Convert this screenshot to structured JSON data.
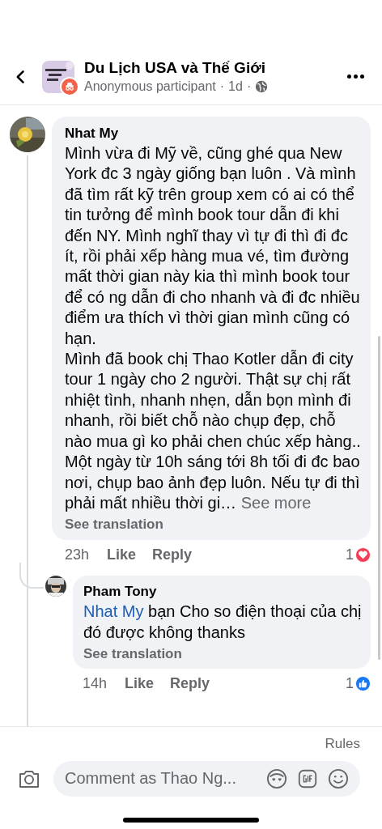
{
  "header": {
    "title": "Du Lịch USA và Thế Giới",
    "subtitle_parts": [
      "Anonymous participant",
      "·",
      "1d",
      "·"
    ]
  },
  "comments": [
    {
      "author": "Nhat My",
      "paragraphs": [
        "Mình vừa đi Mỹ về, cũng ghé qua New York đc 3 ngày giống bạn luôn . Và mình đã tìm rất kỹ trên group xem có ai có thể tin tưởng để mình book tour dẫn đi khi đến NY. Mình nghĩ thay vì tự đi thì đi đc ít, rồi phải xếp hàng mua vé, tìm đường mất thời gian này kia thì mình book tour để có ng dẫn đi cho nhanh và đi đc nhiều điểm ưa thích vì thời gian mình cũng có hạn.",
        "Mình đã book chị Thao Kotler dẫn đi city tour 1 ngày cho 2 người. Thật sự chị rất nhiệt tình, nhanh nhẹn, dẫn bọn mình đi nhanh, rồi biết chỗ nào chụp đẹp, chỗ nào mua gì ko phải chen chúc xếp hàng..",
        "Một ngày từ 10h sáng tới 8h tối đi đc bao nơi, chụp bao ảnh đẹp luôn. Nếu tự đi thì phải mất nhiều thời gi…"
      ],
      "see_more": "See more",
      "translation": "See translation",
      "time": "23h",
      "like": "Like",
      "reply": "Reply",
      "reactions": [
        {
          "kind": "love",
          "count": "1"
        }
      ],
      "replies": [
        {
          "author": "Pham Tony",
          "mention": "Nhat My",
          "paragraphs": [
            "bạn Cho so điện thoại của chị đó được không thanks"
          ],
          "translation": "See translation",
          "time": "14h",
          "like": "Like",
          "reply": "Reply",
          "reactions": [
            {
              "kind": "like",
              "count": "1"
            }
          ]
        }
      ]
    }
  ],
  "footer": {
    "rules": "Rules",
    "placeholder": "Comment as Thao Ng..."
  }
}
